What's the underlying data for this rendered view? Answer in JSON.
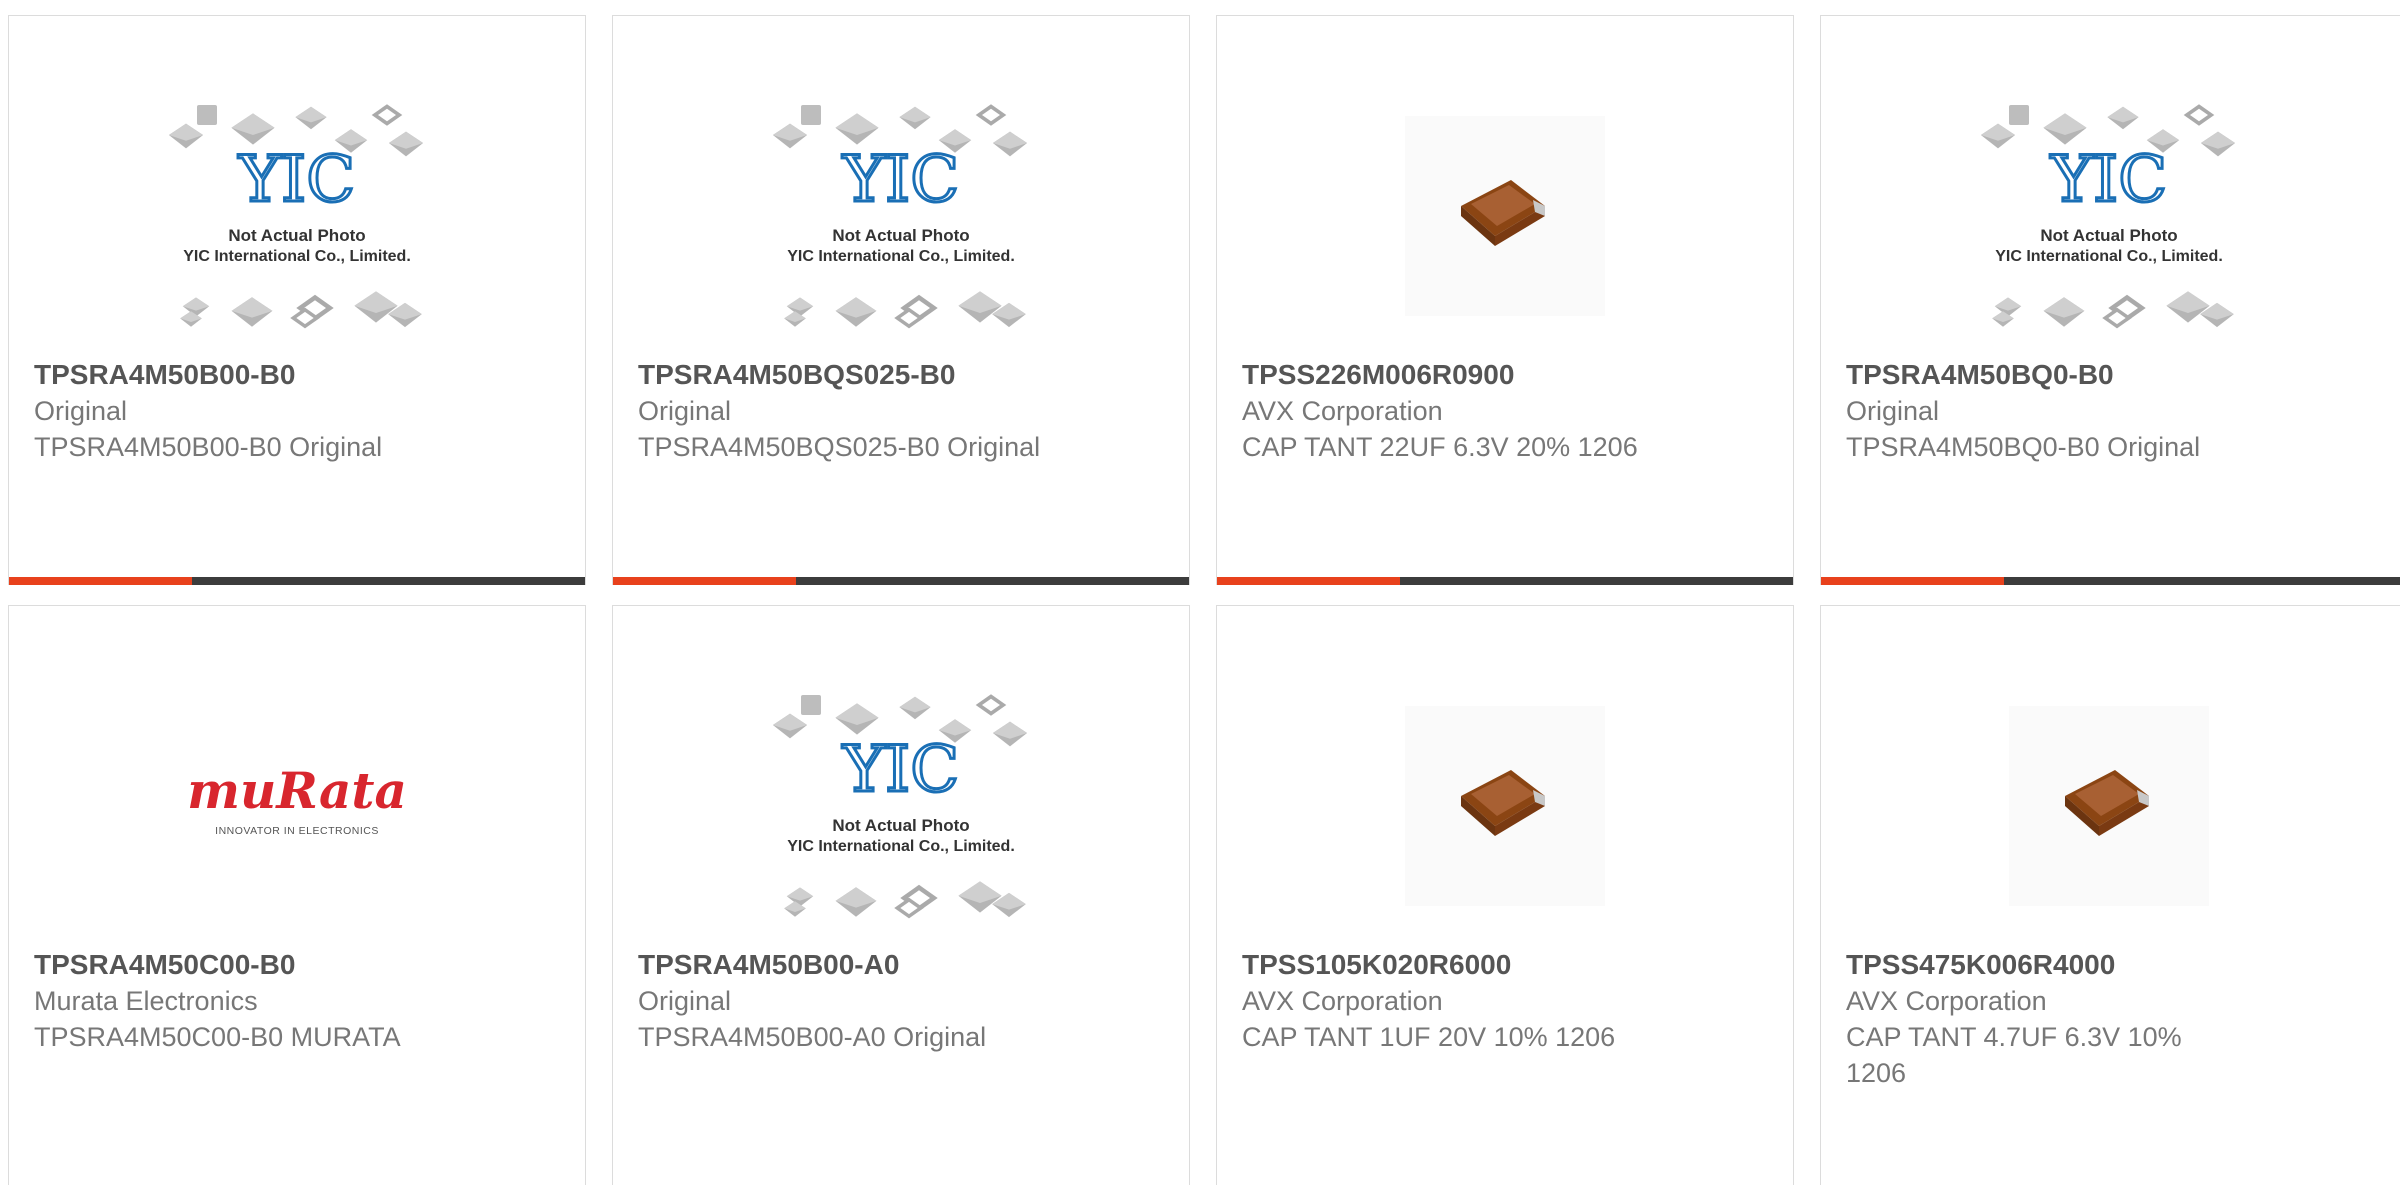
{
  "colors": {
    "accent": "#e8411c",
    "bar": "#3c3c3c",
    "part_number": "#555555",
    "text": "#777777",
    "yic_blue": "#1a6fb5",
    "murata_red": "#d8262e",
    "capacitor_brown": "#a0522d"
  },
  "yic_placeholder": {
    "logo": "YIC",
    "line1": "Not Actual Photo",
    "line2": "YIC International Co., Limited."
  },
  "murata_logo": {
    "wordmark": "muRata",
    "tagline": "INNOVATOR IN ELECTRONICS"
  },
  "products": [
    {
      "part_number": "TPSRA4M50B00-B0",
      "manufacturer": "Original",
      "description": "TPSRA4M50B00-B0 Original",
      "image": "yic-placeholder"
    },
    {
      "part_number": "TPSRA4M50BQS025-B0",
      "manufacturer": "Original",
      "description": "TPSRA4M50BQS025-B0 Original",
      "image": "yic-placeholder"
    },
    {
      "part_number": "TPSS226M006R0900",
      "manufacturer": "AVX Corporation",
      "description": "CAP TANT 22UF 6.3V 20% 1206",
      "image": "tantalum-capacitor"
    },
    {
      "part_number": "TPSRA4M50BQ0-B0",
      "manufacturer": "Original",
      "description": "TPSRA4M50BQ0-B0 Original",
      "image": "yic-placeholder"
    },
    {
      "part_number": "TPSRA4M50C00-B0",
      "manufacturer": "Murata Electronics",
      "description": "TPSRA4M50C00-B0 MURATA",
      "image": "murata-logo"
    },
    {
      "part_number": "TPSRA4M50B00-A0",
      "manufacturer": "Original",
      "description": "TPSRA4M50B00-A0 Original",
      "image": "yic-placeholder"
    },
    {
      "part_number": "TPSS105K020R6000",
      "manufacturer": "AVX Corporation",
      "description": "CAP TANT 1UF 20V 10% 1206",
      "image": "tantalum-capacitor"
    },
    {
      "part_number": "TPSS475K006R4000",
      "manufacturer": "AVX Corporation",
      "description": "CAP TANT 4.7UF 6.3V 10% 1206",
      "image": "tantalum-capacitor"
    }
  ]
}
